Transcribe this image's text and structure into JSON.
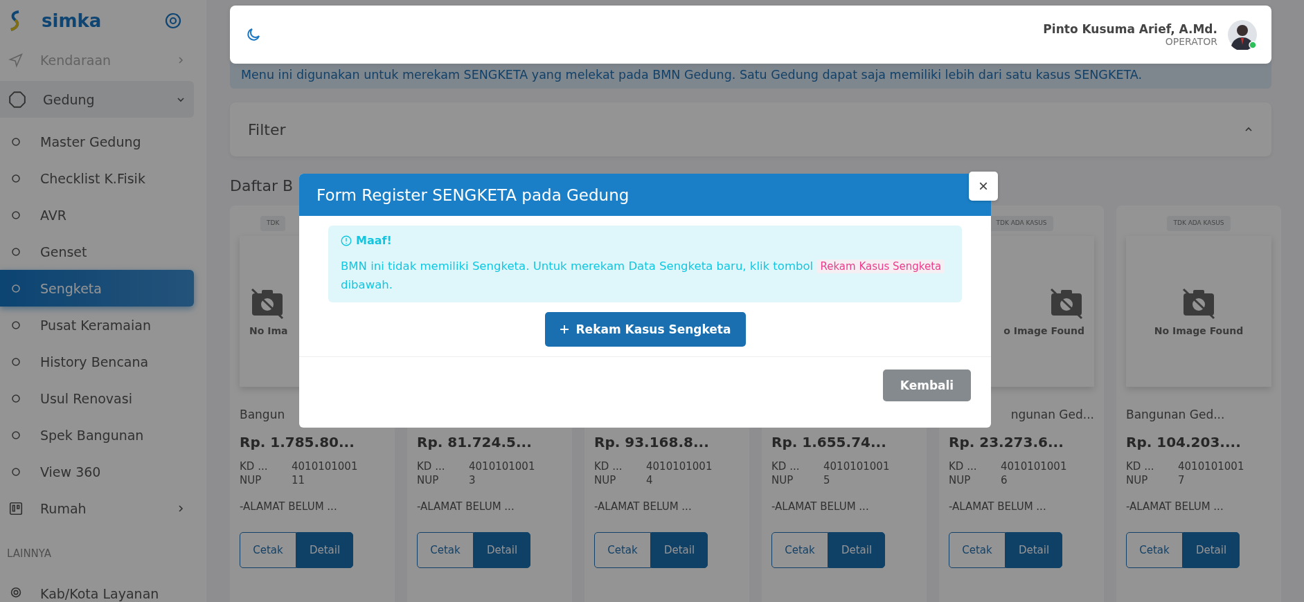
{
  "sidebar": {
    "brand": "simka",
    "items": [
      {
        "label": "Kendaraan",
        "expanded": false,
        "faded": true
      },
      {
        "label": "Gedung",
        "expanded": true,
        "faded": false,
        "children": [
          {
            "label": "Master Gedung",
            "selected": false
          },
          {
            "label": "Checklist K.Fisik",
            "selected": false
          },
          {
            "label": "AVR",
            "selected": false
          },
          {
            "label": "Genset",
            "selected": false
          },
          {
            "label": "Sengketa",
            "selected": true
          },
          {
            "label": "Pusat Keramaian",
            "selected": false
          },
          {
            "label": "History Bencana",
            "selected": false
          },
          {
            "label": "Usul Renovasi",
            "selected": false
          },
          {
            "label": "Spek Bangunan",
            "selected": false
          },
          {
            "label": "View 360",
            "selected": false
          }
        ]
      },
      {
        "label": "Rumah",
        "expanded": false,
        "faded": false
      }
    ],
    "section": "LAINNYA",
    "more": [
      {
        "label": "Kab/Kota Layanan"
      }
    ]
  },
  "header": {
    "user_name": "Pinto Kusuma Arief, A.Md.",
    "role": "OPERATOR",
    "online": true
  },
  "info": "Menu ini digunakan untuk merekam SENGKETA yang melekat pada BMN Gedung. Satu Gedung dapat saja memiliki lebih dari satu kasus SENGKETA.",
  "filter": {
    "title": "Filter",
    "expanded": true
  },
  "list_title": "Daftar B",
  "cards": [
    {
      "badge": "TDK",
      "no_image": "No Ima",
      "title": "Bangun",
      "price": "Rp. 1.785.80...",
      "kd_label": "KD ...",
      "kd": "4010101001",
      "nup_label": "NUP",
      "nup": "11",
      "address": "-ALAMAT BELUM ...",
      "print": "Cetak",
      "detail": "Detail"
    },
    {
      "price": "Rp. 81.724.5...",
      "kd_label": "KD ...",
      "kd": "4010101001",
      "nup_label": "NUP",
      "nup": "3",
      "address": "-ALAMAT BELUM ...",
      "print": "Cetak",
      "detail": "Detail"
    },
    {
      "price": "Rp. 93.168.8...",
      "kd_label": "KD ...",
      "kd": "4010101001",
      "nup_label": "NUP",
      "nup": "4",
      "address": "-ALAMAT BELUM ...",
      "print": "Cetak",
      "detail": "Detail"
    },
    {
      "price": "Rp. 1.655.74...",
      "kd_label": "KD ...",
      "kd": "4010101001",
      "nup_label": "NUP",
      "nup": "5",
      "address": "-ALAMAT BELUM ...",
      "print": "Cetak",
      "detail": "Detail"
    },
    {
      "badge": "TDK ADA KASUS",
      "no_image": "o Image Found",
      "title": "ngunan Ged...",
      "price": "Rp. 23.273.6...",
      "kd_label": "KD ...",
      "kd": "4010101001",
      "nup_label": "NUP",
      "nup": "6",
      "address": "-ALAMAT BELUM ...",
      "print": "Cetak",
      "detail": "Detail"
    },
    {
      "badge": "TDK ADA KASUS",
      "no_image": "No Image Found",
      "title": "Bangunan Ged...",
      "price": "Rp. 104.203....",
      "kd_label": "KD ...",
      "kd": "4010101001",
      "nup_label": "NUP",
      "nup": "7",
      "address": "-ALAMAT BELUM ...",
      "print": "Cetak",
      "detail": "Detail"
    }
  ],
  "modal": {
    "title": "Form Register SENGKETA pada Gedung",
    "close": "×",
    "alert_title": "Maaf!",
    "alert_text": "BMN ini tidak memiliki Sengketa. Untuk merekam Data Sengketa baru, klik tombol ",
    "alert_code": "Rekam Kasus Sengketa",
    "alert_tail": " dibawah.",
    "add_button": "Rekam Kasus Sengketa",
    "back_button": "Kembali"
  }
}
